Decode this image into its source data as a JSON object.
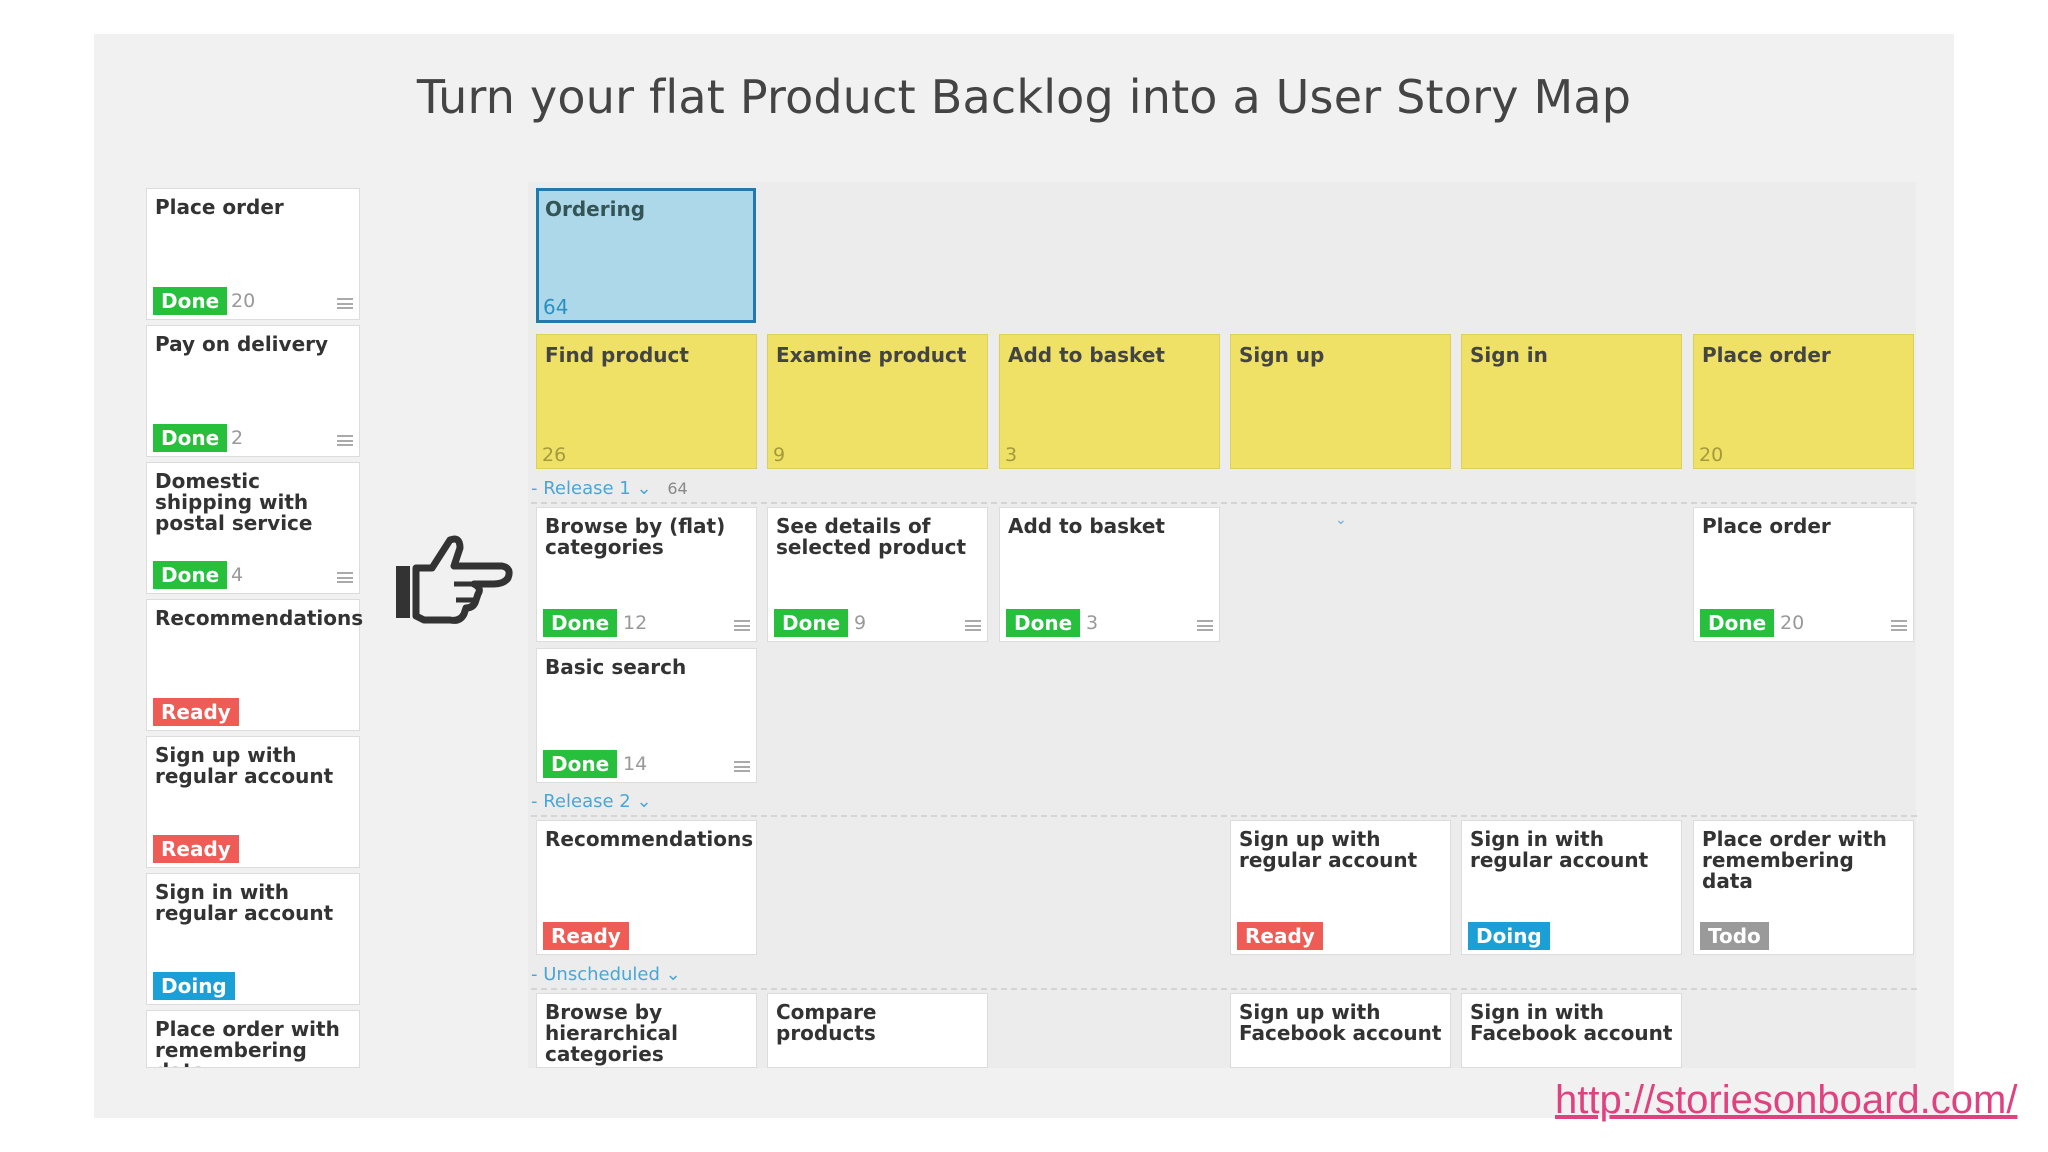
{
  "title": "Turn your flat Product Backlog into a User Story Map",
  "url": "http://storiesonboard.com/",
  "backlog": [
    {
      "title": "Place order",
      "status": "Done",
      "count": "20"
    },
    {
      "title": "Pay on delivery",
      "status": "Done",
      "count": "2"
    },
    {
      "title": "Domestic shipping with postal service",
      "status": "Done",
      "count": "4"
    },
    {
      "title": "Recommendations",
      "status": "Ready",
      "count": ""
    },
    {
      "title": "Sign up with regular account",
      "status": "Ready",
      "count": ""
    },
    {
      "title": "Sign in with regular account",
      "status": "Doing",
      "count": ""
    },
    {
      "title": "Place order with remembering data",
      "status": "",
      "count": ""
    }
  ],
  "map": {
    "epic": {
      "title": "Ordering",
      "count": "64"
    },
    "activities": [
      {
        "title": "Find product",
        "count": "26"
      },
      {
        "title": "Examine product",
        "count": "9"
      },
      {
        "title": "Add to basket",
        "count": "3"
      },
      {
        "title": "Sign up",
        "count": ""
      },
      {
        "title": "Sign in",
        "count": ""
      },
      {
        "title": "Place order",
        "count": "20"
      }
    ],
    "release1": {
      "label": "Release 1",
      "count": "64"
    },
    "release2": {
      "label": "Release 2"
    },
    "unscheduled": {
      "label": "Unscheduled"
    },
    "r1_cards": [
      {
        "title": "Browse by (flat) categories",
        "status": "Done",
        "count": "12"
      },
      {
        "title": "See details of selected product",
        "status": "Done",
        "count": "9"
      },
      {
        "title": "Add to basket",
        "status": "Done",
        "count": "3"
      },
      {
        "title": "Place order",
        "status": "Done",
        "count": "20"
      },
      {
        "title": "Basic search",
        "status": "Done",
        "count": "14"
      }
    ],
    "r2_cards": [
      {
        "title": "Recommendations",
        "status": "Ready"
      },
      {
        "title": "Sign up with regular account",
        "status": "Ready"
      },
      {
        "title": "Sign in with regular account",
        "status": "Doing"
      },
      {
        "title": "Place order with remembering data",
        "status": "Todo"
      }
    ],
    "un_cards": [
      {
        "title": "Browse by hierarchical categories"
      },
      {
        "title": "Compare products"
      },
      {
        "title": "Sign up with Facebook account"
      },
      {
        "title": "Sign in with Facebook account"
      }
    ]
  },
  "colors": {
    "done": "#27c03c",
    "ready": "#ef5b55",
    "doing": "#1aa0d6",
    "todo": "#9a9a9a",
    "activity": "#efe066",
    "epic": "#add8ea",
    "link": "#e0417f"
  }
}
